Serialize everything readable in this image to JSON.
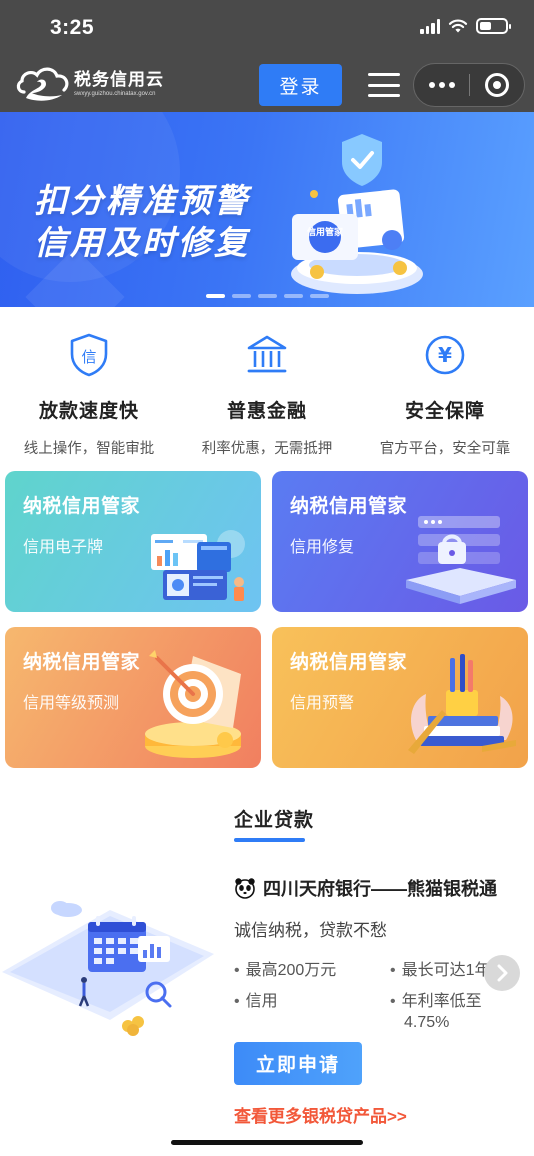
{
  "status_bar": {
    "time": "3:25"
  },
  "header": {
    "logo_name": "税务信用云",
    "logo_url": "swxyy.guizhou.chinatax.gov.cn",
    "login_label": "登录"
  },
  "banner": {
    "line1": "扣分精准预警",
    "line2": "信用及时修复",
    "badge": "信用管家",
    "active_slide": 1,
    "slide_count": 5
  },
  "features": [
    {
      "icon": "shield-credit-icon",
      "glyph": "信",
      "title": "放款速度快",
      "subtitle": "线上操作，智能审批"
    },
    {
      "icon": "bank-icon",
      "title": "普惠金融",
      "subtitle": "利率优惠，无需抵押"
    },
    {
      "icon": "yen-icon",
      "glyph": "¥",
      "title": "安全保障",
      "subtitle": "官方平台，安全可靠"
    }
  ],
  "cards": [
    {
      "title": "纳税信用管家",
      "subtitle": "信用电子牌",
      "color": "#5fd4cc"
    },
    {
      "title": "纳税信用管家",
      "subtitle": "信用修复",
      "color": "#5a7cf2"
    },
    {
      "title": "纳税信用管家",
      "subtitle": "信用等级预测",
      "color": "#f6b86e"
    },
    {
      "title": "纳税信用管家",
      "subtitle": "信用预警",
      "color": "#f8c15a"
    }
  ],
  "loan": {
    "section_title": "企业贷款",
    "bank_name": "四川天府银行——熊猫银税通",
    "slogan": "诚信纳税，贷款不愁",
    "features": [
      "最高200万元",
      "最长可达1年",
      "信用",
      "年利率低至"
    ],
    "rate": "4.75%",
    "apply_label": "立即申请",
    "more_link": "查看更多银税贷产品>>"
  },
  "colors": {
    "accent": "#2f7cf6",
    "link": "#f2583a"
  }
}
